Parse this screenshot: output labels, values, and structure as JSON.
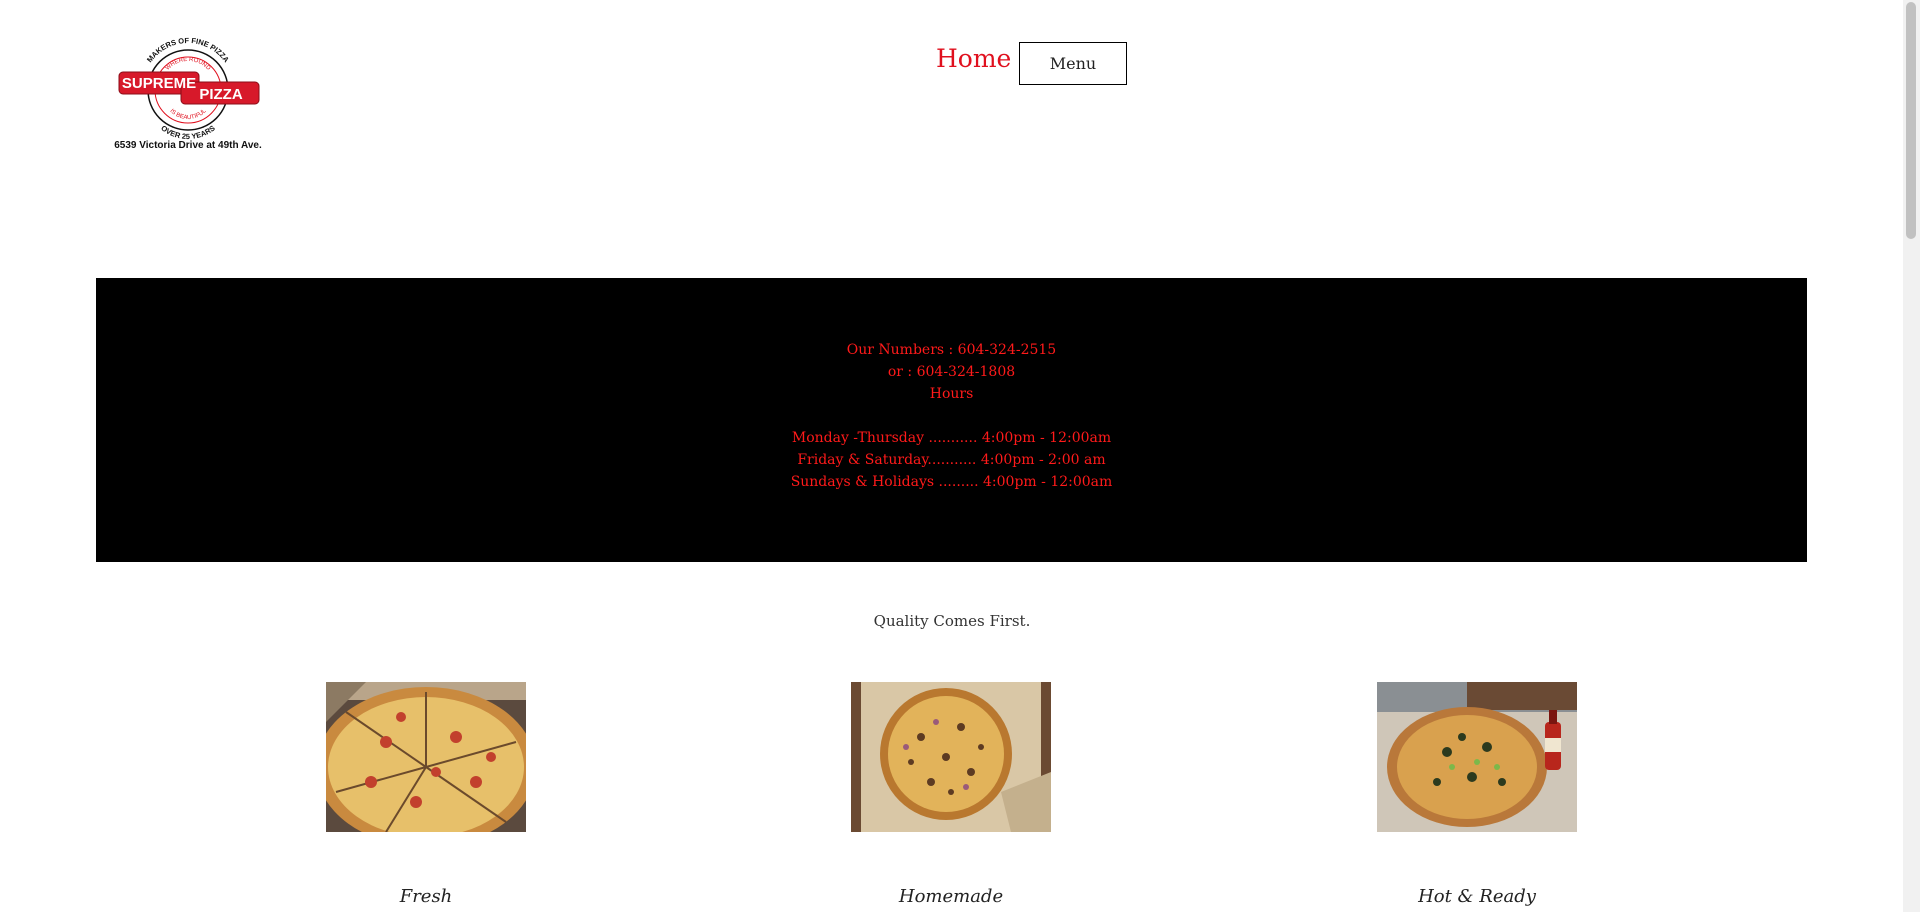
{
  "header": {
    "logo": {
      "top_arc": "MAKERS OF FINE PIZZA",
      "inner_top": "WHERE ROUND",
      "word1": "SUPREME",
      "word2": "PIZZA",
      "inner_bottom": "IS BEAUTIFUL",
      "bottom_arc": "OVER 25 YEARS",
      "address": "6539 Victoria Drive at 49th Ave."
    },
    "nav": {
      "home_label": "Home",
      "menu_label": "Menu"
    }
  },
  "info": {
    "numbers_line1": "Our Numbers : 604-324-2515",
    "numbers_line2": "or : 604-324-1808",
    "hours_title": "Hours",
    "hours_line1": "Monday -Thursday ........... 4:00pm - 12:00am",
    "hours_line2": "Friday & Saturday........... 4:00pm - 2:00 am",
    "hours_line3": "Sundays & Holidays ......... 4:00pm - 12:00am"
  },
  "tagline": "Quality Comes First.",
  "features": [
    {
      "caption": "Fresh"
    },
    {
      "caption": "Homemade"
    },
    {
      "caption": "Hot & Ready"
    }
  ],
  "colors": {
    "accent_red": "#e0101e",
    "band_black": "#000000",
    "band_text": "#ff1a1a"
  }
}
